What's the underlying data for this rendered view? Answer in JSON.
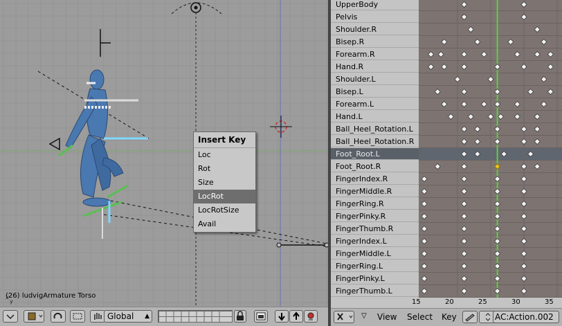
{
  "viewport": {
    "status_text": "(26) ludvigArmature Torso",
    "axis_x": "x",
    "axis_y": "y"
  },
  "insert_key_menu": {
    "title": "Insert Key",
    "items": [
      "Loc",
      "Rot",
      "Size",
      "LocRot",
      "LocRotSize",
      "Avail"
    ],
    "selected_index": 3
  },
  "view_header": {
    "orientation_value": "Global",
    "icons": [
      "view-menu-icon",
      "object-mode-icon",
      "rotate-pivot-icon",
      "manipulator-icon",
      "hand-icon",
      "layer-buttons",
      "lock-icon",
      "render-icon",
      "copy-down-icon",
      "paste-up-icon",
      "record-icon"
    ]
  },
  "action_editor": {
    "channels": [
      "UpperBody",
      "Pelvis",
      "Shoulder.R",
      "Bisep.R",
      "Forearm.R",
      "Hand.R",
      "Shoulder.L",
      "Bisep.L",
      "Forearm.L",
      "Hand.L",
      "Ball_Heel_Rotation.L",
      "Ball_Heel_Rotation.R",
      "Foot_Root.L",
      "Foot_Root.R",
      "FingerIndex.R",
      "FingerMiddle.R",
      "FingerRing.R",
      "FingerPinky.R",
      "FingerThumb.R",
      "FingerIndex.L",
      "FingerMiddle.L",
      "FingerRing.L",
      "FingerPinky.L",
      "FingerThumb.L"
    ],
    "selected_channel_index": 12,
    "ruler_ticks": [
      "15",
      "20",
      "25",
      "30",
      "35"
    ],
    "current_frame": 26,
    "keyframes": [
      [
        21,
        30
      ],
      [
        21,
        30
      ],
      [
        22,
        32
      ],
      [
        18,
        23,
        28,
        33
      ],
      [
        16,
        17.5,
        21,
        24,
        29,
        32,
        34
      ],
      [
        16,
        18,
        21,
        26,
        30,
        34
      ],
      [
        20,
        25,
        33
      ],
      [
        17,
        21,
        26,
        31,
        34
      ],
      [
        18,
        21,
        24,
        26,
        29,
        33
      ],
      [
        19,
        22,
        25,
        26.5,
        29,
        32
      ],
      [
        21,
        23,
        26,
        30,
        32
      ],
      [
        21,
        23,
        26,
        30,
        32
      ],
      [
        21,
        23,
        27,
        31
      ],
      [
        17,
        21,
        26,
        30,
        32
      ],
      [
        15,
        21,
        26,
        30
      ],
      [
        15,
        21,
        26,
        30
      ],
      [
        15,
        21,
        26,
        30
      ],
      [
        15,
        21,
        26,
        30
      ],
      [
        15,
        21,
        26,
        30
      ],
      [
        15,
        21,
        26,
        30
      ],
      [
        15,
        21,
        26,
        30
      ],
      [
        15,
        21,
        26,
        30
      ],
      [
        15,
        21,
        26,
        30
      ],
      [
        15,
        21,
        26,
        30
      ]
    ],
    "highlighted_key": {
      "row": 13,
      "frame": 26
    }
  },
  "action_header": {
    "menus": [
      "View",
      "Select",
      "Key"
    ],
    "action_name": "AC:Action.002"
  },
  "colors": {
    "viewport_bg": "#9c9c9c",
    "keyframe_bg": "#7d7472",
    "current_frame": "#5fcf3f",
    "bone_blue": "#4a78b0",
    "selected_bone": "#7fd8ff"
  }
}
